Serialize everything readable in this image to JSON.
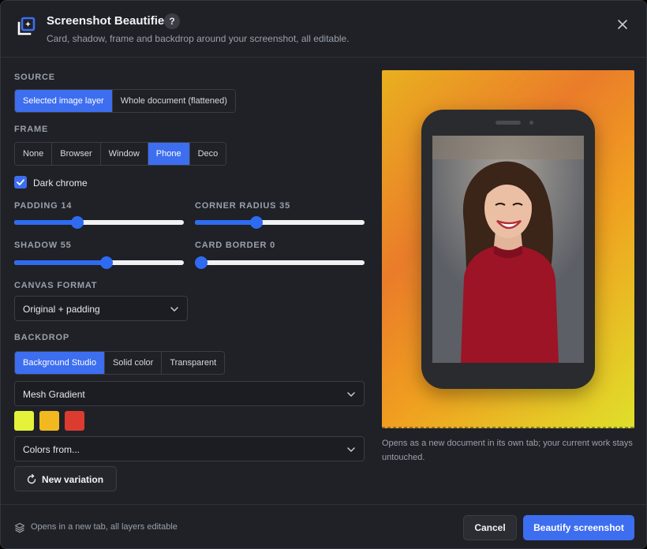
{
  "header": {
    "title": "Screenshot Beautifier",
    "help_label": "?",
    "subtitle": "Card, shadow, frame and backdrop around your screenshot, all editable."
  },
  "source": {
    "label": "SOURCE",
    "options": [
      "Selected image layer",
      "Whole document (flattened)"
    ],
    "selected": "Selected image layer"
  },
  "frame": {
    "label": "FRAME",
    "options": [
      "None",
      "Browser",
      "Window",
      "Phone",
      "Deco"
    ],
    "selected": "Phone"
  },
  "dark_chrome": {
    "label": "Dark chrome",
    "checked": true
  },
  "sliders": {
    "padding": {
      "label": "PADDING 14",
      "value": 14,
      "fraction": 0.36
    },
    "corner_radius": {
      "label": "CORNER RADIUS 35",
      "value": 35,
      "fraction": 0.35
    },
    "shadow": {
      "label": "SHADOW 55",
      "value": 55,
      "fraction": 0.55
    },
    "card_border": {
      "label": "CARD BORDER 0",
      "value": 0,
      "fraction": 0.0
    }
  },
  "canvas_format": {
    "label": "CANVAS FORMAT",
    "value": "Original + padding"
  },
  "backdrop": {
    "label": "BACKDROP",
    "options": [
      "Background Studio",
      "Solid color",
      "Transparent"
    ],
    "selected": "Background Studio",
    "style_value": "Mesh Gradient",
    "swatches": [
      "#e4f23a",
      "#f2b81f",
      "#dc3b2f"
    ],
    "colors_from": "Colors from..."
  },
  "new_variation_label": "New variation",
  "preview_note": "Opens as a new document in its own tab; your current work stays untouched.",
  "footer": {
    "note": "Opens in a new tab, all layers editable",
    "cancel_label": "Cancel",
    "primary_label": "Beautify screenshot"
  },
  "colors": {
    "accent": "#3d6ef0",
    "background": "#1f2127"
  }
}
